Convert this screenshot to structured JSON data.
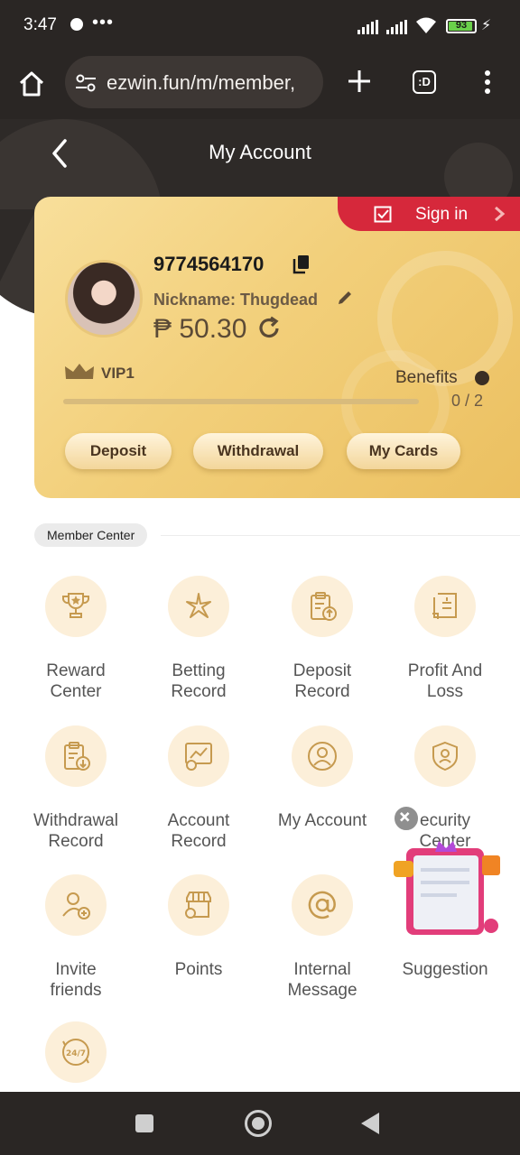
{
  "status_bar": {
    "time": "3:47",
    "dots": "•••",
    "battery": "93",
    "battery_level": 0.93
  },
  "browser": {
    "url": "ezwin.fun/m/member,",
    "tab_count_label": ":D"
  },
  "header": {
    "title": "My Account"
  },
  "card": {
    "signin_label": "Sign in",
    "user_id": "9774564170",
    "nickname": "Nickname: Thugdead",
    "balance": "₱ 50.30",
    "vip_label": "VIP1",
    "benefits_label": "Benefits",
    "progress_text": "0 / 2",
    "progress_value": 0,
    "buttons": {
      "deposit": "Deposit",
      "withdrawal": "Withdrawal",
      "my_cards": "My Cards"
    }
  },
  "member_center": {
    "title": "Member Center",
    "items": [
      {
        "label": "Reward Center",
        "icon": "trophy-icon"
      },
      {
        "label": "Betting Record",
        "icon": "sparkle-icon"
      },
      {
        "label": "Deposit Record",
        "icon": "clipboard-upload-icon"
      },
      {
        "label": "Profit And Loss",
        "icon": "receipt-icon"
      },
      {
        "label": "Withdrawal Record",
        "icon": "clipboard-download-icon"
      },
      {
        "label": "Account Record",
        "icon": "monitor-chart-icon"
      },
      {
        "label": "My Account",
        "icon": "user-circle-icon"
      },
      {
        "label": "ecurity Center",
        "icon": "shield-user-icon"
      },
      {
        "label": "Invite friends",
        "icon": "user-add-icon"
      },
      {
        "label": "Points",
        "icon": "store-icon"
      },
      {
        "label": "Internal Message",
        "icon": "at-icon"
      },
      {
        "label": "Suggestion",
        "icon": "gift-book-icon"
      },
      {
        "label": "",
        "icon": "support-24-7-icon"
      }
    ]
  },
  "colors": {
    "accent_gold": "#f2cf7a",
    "signin_red": "#d6283b",
    "icon_bg": "#fcefd9",
    "icon_stroke": "#c69a4f"
  }
}
